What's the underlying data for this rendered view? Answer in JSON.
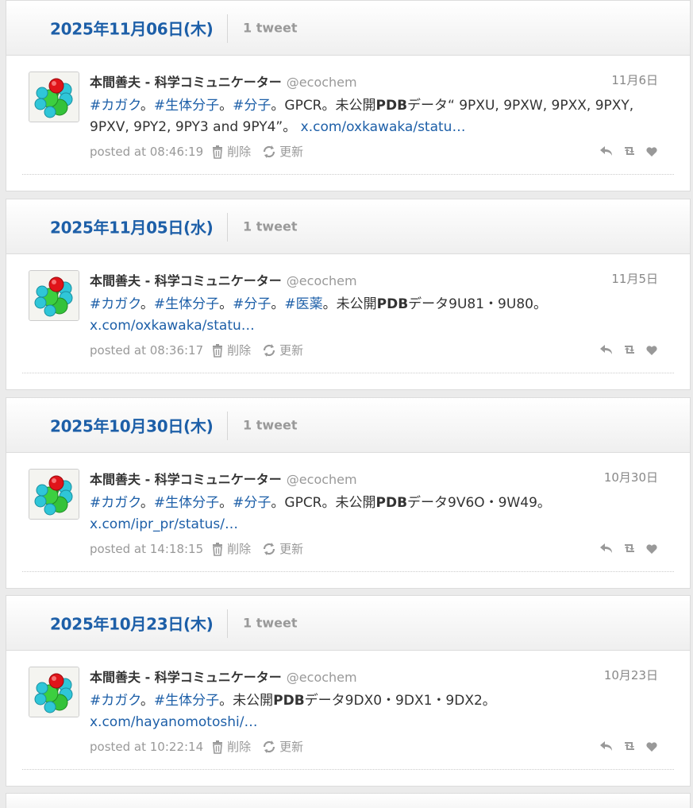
{
  "days": [
    {
      "date": "2025年11月06日(木)",
      "count": "1 tweet",
      "tweet": {
        "name": "本間善夫 - 科学コミュニケーター",
        "handle": "@ecochem",
        "date": "11月6日",
        "segments": [
          {
            "text": "#カガク",
            "style": "hashtag"
          },
          {
            "text": "。",
            "style": "text"
          },
          {
            "text": "#生体分子",
            "style": "hashtag"
          },
          {
            "text": "。",
            "style": "text"
          },
          {
            "text": "#分子",
            "style": "hashtag"
          },
          {
            "text": "。GPCR。未公開",
            "style": "text"
          },
          {
            "text": "PDB",
            "style": "bold"
          },
          {
            "text": "データ“ 9PXU, 9PXW, 9PXX, 9PXY, 9PXV, 9PY2, 9PY3 and 9PY4”。 ",
            "style": "text"
          },
          {
            "text": "x.com/oxkawaka/statu…",
            "style": "link"
          }
        ],
        "posted": "posted at 08:46:19",
        "delete_label": "削除",
        "update_label": "更新"
      }
    },
    {
      "date": "2025年11月05日(水)",
      "count": "1 tweet",
      "tweet": {
        "name": "本間善夫 - 科学コミュニケーター",
        "handle": "@ecochem",
        "date": "11月5日",
        "segments": [
          {
            "text": "#カガク",
            "style": "hashtag"
          },
          {
            "text": "。",
            "style": "text"
          },
          {
            "text": "#生体分子",
            "style": "hashtag"
          },
          {
            "text": "。",
            "style": "text"
          },
          {
            "text": "#分子",
            "style": "hashtag"
          },
          {
            "text": "。",
            "style": "text"
          },
          {
            "text": "#医薬",
            "style": "hashtag"
          },
          {
            "text": "。未公開",
            "style": "text"
          },
          {
            "text": "PDB",
            "style": "bold"
          },
          {
            "text": "データ9U81・9U80。 ",
            "style": "text"
          },
          {
            "text": "x.com/oxkawaka/statu…",
            "style": "link"
          }
        ],
        "posted": "posted at 08:36:17",
        "delete_label": "削除",
        "update_label": "更新"
      }
    },
    {
      "date": "2025年10月30日(木)",
      "count": "1 tweet",
      "tweet": {
        "name": "本間善夫 - 科学コミュニケーター",
        "handle": "@ecochem",
        "date": "10月30日",
        "segments": [
          {
            "text": "#カガク",
            "style": "hashtag"
          },
          {
            "text": "。",
            "style": "text"
          },
          {
            "text": "#生体分子",
            "style": "hashtag"
          },
          {
            "text": "。",
            "style": "text"
          },
          {
            "text": "#分子",
            "style": "hashtag"
          },
          {
            "text": "。GPCR。未公開",
            "style": "text"
          },
          {
            "text": "PDB",
            "style": "bold"
          },
          {
            "text": "データ9V6O・9W49。 ",
            "style": "text"
          },
          {
            "text": "x.com/ipr_pr/status/…",
            "style": "link"
          }
        ],
        "posted": "posted at 14:18:15",
        "delete_label": "削除",
        "update_label": "更新"
      }
    },
    {
      "date": "2025年10月23日(木)",
      "count": "1 tweet",
      "tweet": {
        "name": "本間善夫 - 科学コミュニケーター",
        "handle": "@ecochem",
        "date": "10月23日",
        "segments": [
          {
            "text": "#カガク",
            "style": "hashtag"
          },
          {
            "text": "。",
            "style": "text"
          },
          {
            "text": "#生体分子",
            "style": "hashtag"
          },
          {
            "text": "。未公開",
            "style": "text"
          },
          {
            "text": "PDB",
            "style": "bold"
          },
          {
            "text": "データ9DX0・9DX1・9DX2。 ",
            "style": "text"
          },
          {
            "text": "x.com/hayanomotoshi/…",
            "style": "link"
          }
        ],
        "posted": "posted at 10:22:14",
        "delete_label": "削除",
        "update_label": "更新"
      }
    }
  ],
  "icons": {
    "delete": "trash-icon",
    "update": "refresh-icon",
    "reply": "reply-icon",
    "retweet": "retweet-icon",
    "like": "heart-icon"
  },
  "colors": {
    "date_header": "#1d5fa8",
    "link": "#1d5fa8",
    "muted": "#999999"
  }
}
